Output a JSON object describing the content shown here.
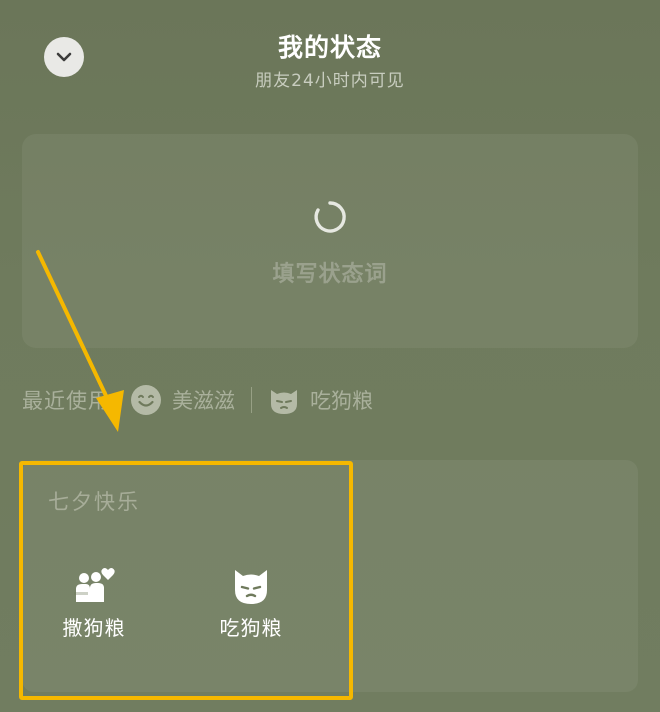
{
  "header": {
    "title": "我的状态",
    "subtitle": "朋友24小时内可见",
    "back_icon": "chevron-down-icon"
  },
  "status_input": {
    "placeholder": "填写状态词",
    "loading": true
  },
  "recent": {
    "label": "最近使用",
    "items": [
      {
        "label": "美滋滋",
        "icon": "smile-face-icon"
      },
      {
        "label": "吃狗粮",
        "icon": "cat-face-icon"
      }
    ]
  },
  "category": {
    "title": "七夕快乐",
    "options": [
      {
        "label": "撒狗粮",
        "icon": "couple-heart-icon"
      },
      {
        "label": "吃狗粮",
        "icon": "cat-face-icon"
      }
    ]
  },
  "colors": {
    "background": "#6f7a5c",
    "highlight": "#f5b800",
    "text_primary": "#ffffff"
  }
}
